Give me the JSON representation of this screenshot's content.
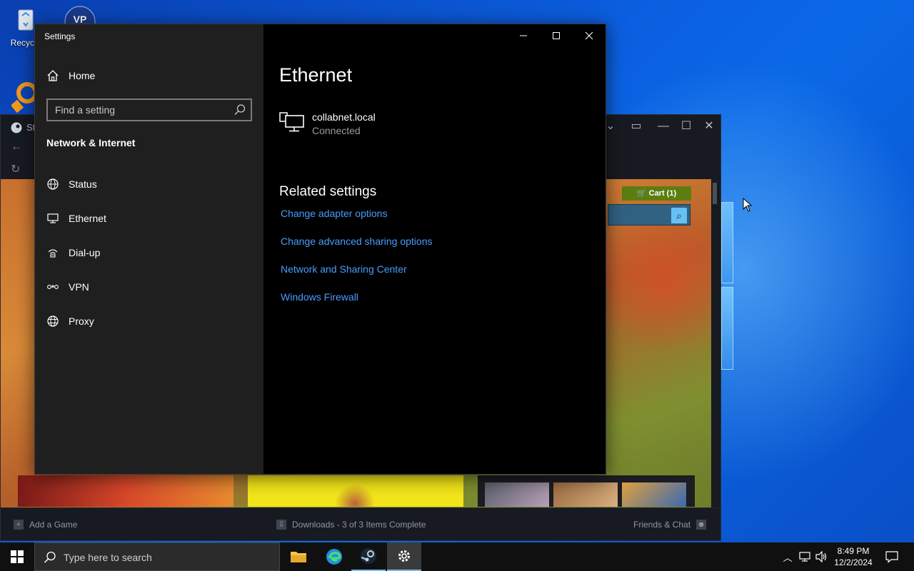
{
  "desktop": {
    "icons": [
      {
        "label": "Recycle",
        "icon": "recycle-bin-icon"
      },
      {
        "label": "",
        "icon": "vpn-app-icon"
      },
      {
        "label": "",
        "icon": "search-app-icon"
      }
    ]
  },
  "steam": {
    "title": "St",
    "cart_label": "Cart (1)",
    "footer": {
      "add_game": "Add a Game",
      "downloads": "Downloads - 3 of 3 Items Complete",
      "friends": "Friends & Chat"
    }
  },
  "settings": {
    "window_title": "Settings",
    "home_label": "Home",
    "search_placeholder": "Find a setting",
    "section_heading": "Network & Internet",
    "nav": [
      {
        "label": "Status",
        "icon": "globe-status-icon"
      },
      {
        "label": "Ethernet",
        "icon": "ethernet-icon"
      },
      {
        "label": "Dial-up",
        "icon": "dialup-icon"
      },
      {
        "label": "VPN",
        "icon": "vpn-icon"
      },
      {
        "label": "Proxy",
        "icon": "globe-icon"
      }
    ],
    "content": {
      "title": "Ethernet",
      "connection_name": "collabnet.local",
      "connection_status": "Connected",
      "related_heading": "Related settings",
      "links": [
        "Change adapter options",
        "Change advanced sharing options",
        "Network and Sharing Center",
        "Windows Firewall"
      ]
    }
  },
  "taskbar": {
    "search_placeholder": "Type here to search",
    "time": "8:49 PM",
    "date": "12/2/2024"
  },
  "colors": {
    "link": "#4c9bff",
    "sidebar_bg": "#1f1f1f",
    "content_bg": "#000000",
    "steam_cart": "#5c7e10",
    "taskbar_accent": "#76b9ed"
  }
}
